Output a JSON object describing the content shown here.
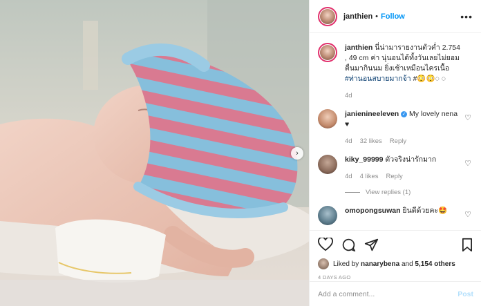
{
  "post": {
    "username": "janthien",
    "follow_label": "Follow",
    "more_label": "•••",
    "separator": "•",
    "caption_user": "janthien",
    "caption_text": "นี่น่ามารายงานตัวค่ำ 2.754 , 49 cm ค่า นุ่นอนได้ทั้งวันเลยไม่ยอมตื่นมากินนม ยิ่งเช้าเหมือนไครเนื้อ",
    "caption_hashtag": "#ท่านอนสบายมากจ้า",
    "caption_emoji": "#😳😳◌ ◌",
    "caption_age": "4d",
    "carousel_arrow": "›"
  },
  "comments": [
    {
      "user": "janienineeleven",
      "verified": true,
      "text": "My lovely nena ♥",
      "age": "4d",
      "likes": "32 likes",
      "reply": "Reply",
      "avatar_color": "#c2896a"
    },
    {
      "user": "kiky_99999",
      "verified": false,
      "text": "ตัวจริงน่ารักมาก",
      "age": "4d",
      "likes": "4 likes",
      "reply": "Reply",
      "avatar_color": "#8a6a5a"
    },
    {
      "user": "omopongsuwan",
      "verified": false,
      "text": "ยินดีด้วยคะ🤩",
      "avatar_color": "#5a7a8a"
    }
  ],
  "view_replies": "View replies (1)",
  "actions": {
    "liked_by_prefix": "Liked by ",
    "liked_by_user": "nanarybena",
    "liked_by_and": " and ",
    "liked_by_count": "5,154 others",
    "date": "4 DAYS AGO"
  },
  "add_comment": {
    "placeholder": "Add a comment...",
    "post_label": "Post"
  },
  "colors": {
    "accent": "#0095f6",
    "hashtag": "#00376b",
    "muted": "#8e8e8e"
  }
}
